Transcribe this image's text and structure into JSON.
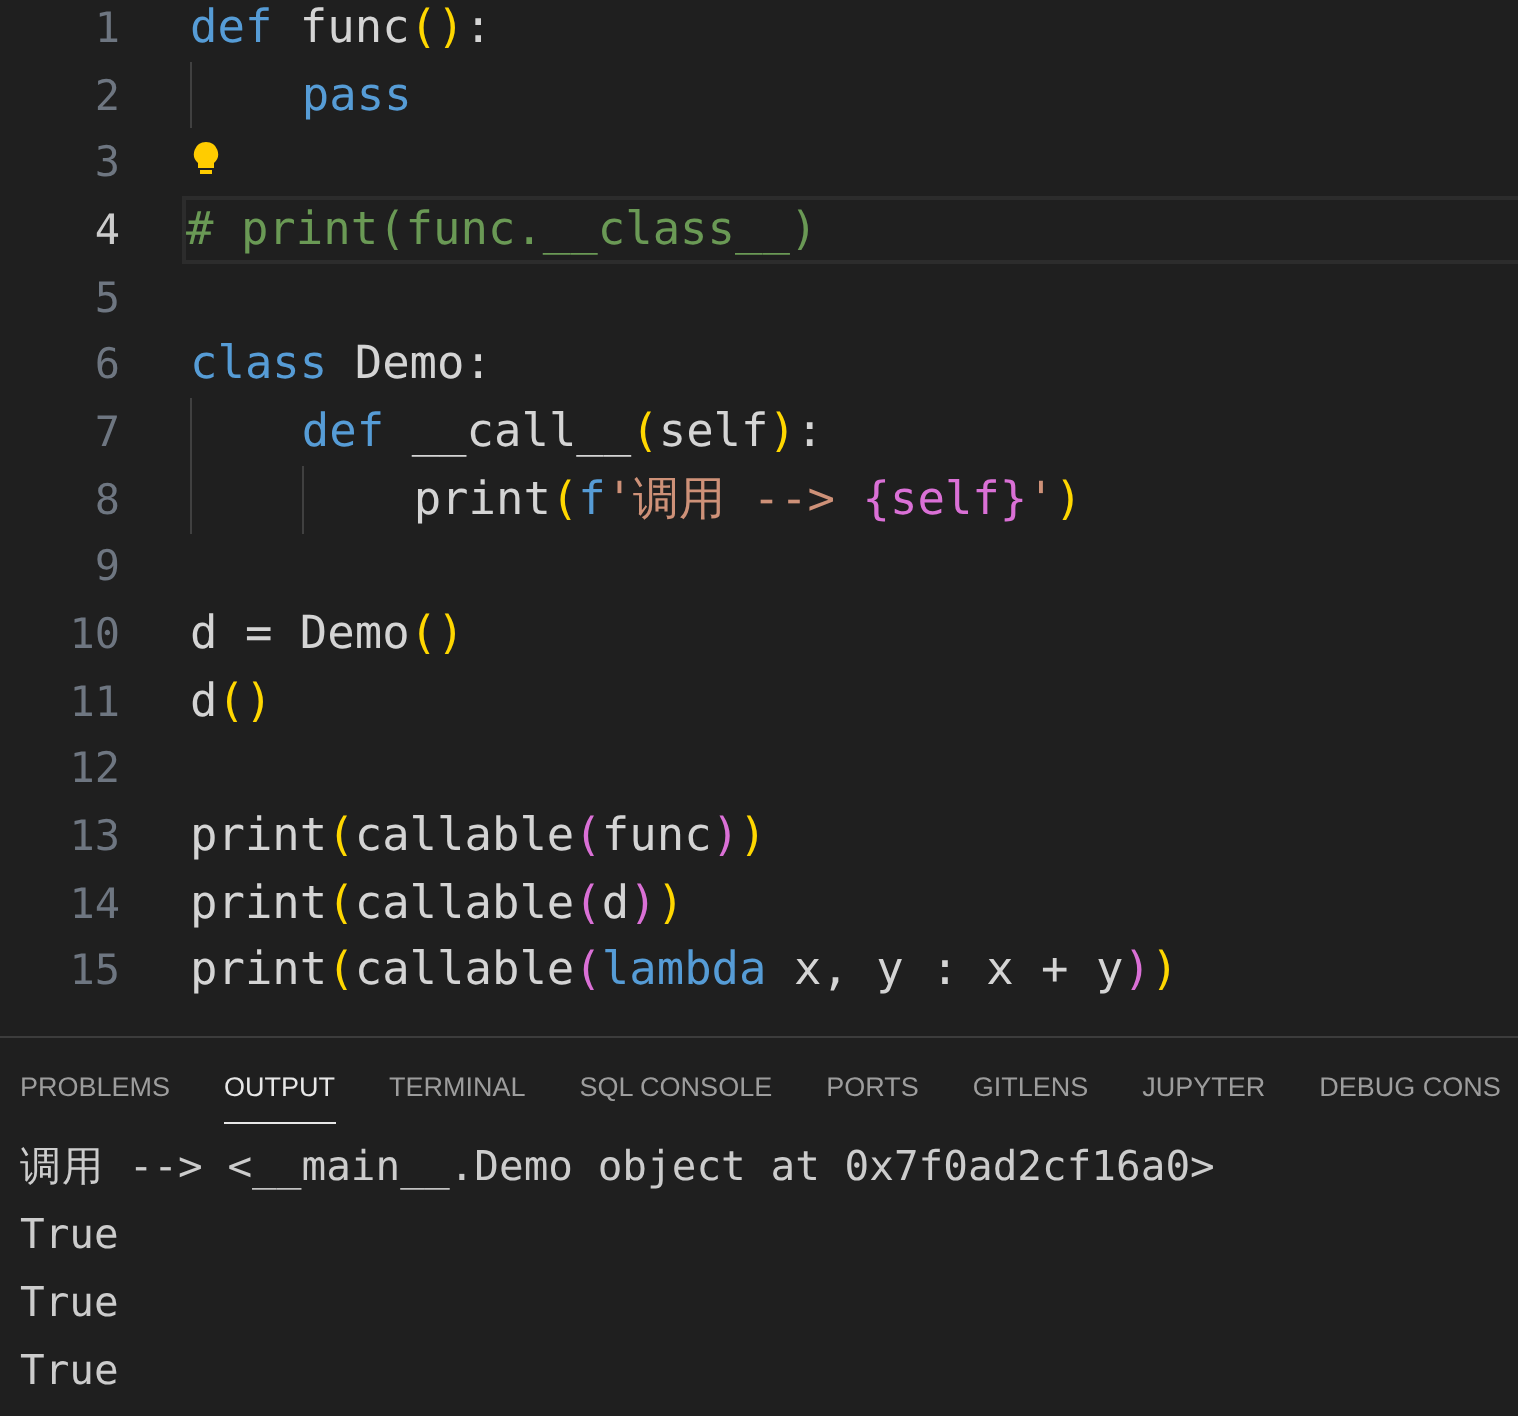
{
  "editor": {
    "lines": [
      {
        "number": "1",
        "current": false,
        "tokens": [
          {
            "text": "def",
            "kind": "keyword"
          },
          {
            "text": " func",
            "kind": "plain"
          },
          {
            "text": "()",
            "kind": "paren1"
          },
          {
            "text": ":",
            "kind": "plain"
          }
        ]
      },
      {
        "number": "2",
        "current": false,
        "tokens": [
          {
            "text": "    pass",
            "kind": "keyword"
          }
        ]
      },
      {
        "number": "3",
        "current": false,
        "lightbulb": true
      },
      {
        "number": "4",
        "current": true,
        "tokens": [
          {
            "text": "# print(func.__class__)",
            "kind": "comment"
          }
        ]
      },
      {
        "number": "5",
        "current": false
      },
      {
        "number": "6",
        "current": false,
        "tokens": [
          {
            "text": "class",
            "kind": "keyword"
          },
          {
            "text": " Demo:",
            "kind": "plain"
          }
        ]
      },
      {
        "number": "7",
        "current": false,
        "tokens": [
          {
            "text": "    def",
            "kind": "keyword"
          },
          {
            "text": " __call__",
            "kind": "plain"
          },
          {
            "text": "(",
            "kind": "paren1"
          },
          {
            "text": "self",
            "kind": "plain"
          },
          {
            "text": ")",
            "kind": "paren1"
          },
          {
            "text": ":",
            "kind": "plain"
          }
        ]
      },
      {
        "number": "8",
        "current": false,
        "tokens": [
          {
            "text": "        print",
            "kind": "plain"
          },
          {
            "text": "(",
            "kind": "paren1"
          },
          {
            "text": "f",
            "kind": "keyword"
          },
          {
            "text": "'调用 --> ",
            "kind": "string"
          },
          {
            "text": "{self}",
            "kind": "paren2"
          },
          {
            "text": "'",
            "kind": "string"
          },
          {
            "text": ")",
            "kind": "paren1"
          }
        ]
      },
      {
        "number": "9",
        "current": false
      },
      {
        "number": "10",
        "current": false,
        "tokens": [
          {
            "text": "d = Demo",
            "kind": "plain"
          },
          {
            "text": "()",
            "kind": "paren1"
          }
        ]
      },
      {
        "number": "11",
        "current": false,
        "tokens": [
          {
            "text": "d",
            "kind": "plain"
          },
          {
            "text": "()",
            "kind": "paren1"
          }
        ]
      },
      {
        "number": "12",
        "current": false
      },
      {
        "number": "13",
        "current": false,
        "tokens": [
          {
            "text": "print",
            "kind": "plain"
          },
          {
            "text": "(",
            "kind": "paren1"
          },
          {
            "text": "callable",
            "kind": "plain"
          },
          {
            "text": "(",
            "kind": "paren2"
          },
          {
            "text": "func",
            "kind": "plain"
          },
          {
            "text": ")",
            "kind": "paren2"
          },
          {
            "text": ")",
            "kind": "paren1"
          }
        ]
      },
      {
        "number": "14",
        "current": false,
        "tokens": [
          {
            "text": "print",
            "kind": "plain"
          },
          {
            "text": "(",
            "kind": "paren1"
          },
          {
            "text": "callable",
            "kind": "plain"
          },
          {
            "text": "(",
            "kind": "paren2"
          },
          {
            "text": "d",
            "kind": "plain"
          },
          {
            "text": ")",
            "kind": "paren2"
          },
          {
            "text": ")",
            "kind": "paren1"
          }
        ]
      },
      {
        "number": "15",
        "current": false,
        "tokens": [
          {
            "text": "print",
            "kind": "plain"
          },
          {
            "text": "(",
            "kind": "paren1"
          },
          {
            "text": "callable",
            "kind": "plain"
          },
          {
            "text": "(",
            "kind": "paren2"
          },
          {
            "text": "lambda",
            "kind": "keyword"
          },
          {
            "text": " x, y : x + y",
            "kind": "plain"
          },
          {
            "text": ")",
            "kind": "paren2"
          },
          {
            "text": ")",
            "kind": "paren1"
          }
        ]
      }
    ]
  },
  "panel": {
    "tabs": [
      {
        "label": "PROBLEMS",
        "selected": false
      },
      {
        "label": "OUTPUT",
        "selected": true
      },
      {
        "label": "TERMINAL",
        "selected": false
      },
      {
        "label": "SQL CONSOLE",
        "selected": false
      },
      {
        "label": "PORTS",
        "selected": false
      },
      {
        "label": "GITLENS",
        "selected": false
      },
      {
        "label": "JUPYTER",
        "selected": false
      },
      {
        "label": "DEBUG CONS",
        "selected": false
      }
    ],
    "output": [
      "调用 --> <__main__.Demo object at 0x7f0ad2cf16a0>",
      "True",
      "True",
      "True"
    ]
  }
}
